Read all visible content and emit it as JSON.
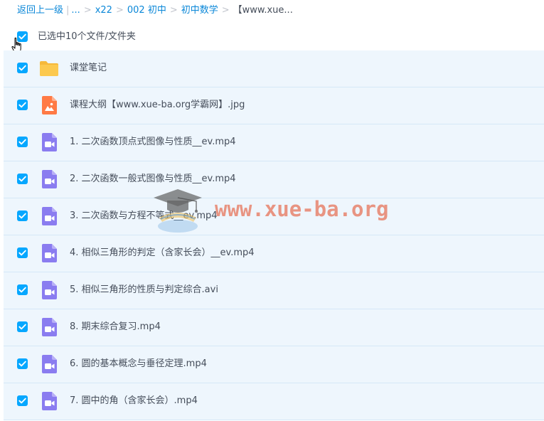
{
  "breadcrumb": {
    "back_label": "返回上一级",
    "ellipsis": "...",
    "items": [
      "x22",
      "002 初中",
      "初中数学"
    ],
    "current": "【www.xue..."
  },
  "selection": {
    "label": "已选中10个文件/文件夹",
    "all_checked": true
  },
  "files": [
    {
      "name": "课堂笔记",
      "type": "folder-icon",
      "checked": true
    },
    {
      "name": "课程大纲【www.xue-ba.org学霸网】.jpg",
      "type": "image-file-icon",
      "checked": true
    },
    {
      "name": "1. 二次函数顶点式图像与性质__ev.mp4",
      "type": "video-file-icon",
      "checked": true
    },
    {
      "name": "2. 二次函数一般式图像与性质__ev.mp4",
      "type": "video-file-icon",
      "checked": true
    },
    {
      "name": "3. 二次函数与方程不等式__ev.mp4",
      "type": "video-file-icon",
      "checked": true
    },
    {
      "name": "4. 相似三角形的判定（含家长会）__ev.mp4",
      "type": "video-file-icon",
      "checked": true
    },
    {
      "name": "5. 相似三角形的性质与判定综合.avi",
      "type": "video-file-icon",
      "checked": true
    },
    {
      "name": "8. 期末综合复习.mp4",
      "type": "video-file-icon",
      "checked": true
    },
    {
      "name": "6. 圆的基本概念与垂径定理.mp4",
      "type": "video-file-icon",
      "checked": true
    },
    {
      "name": "7. 圆中的角（含家长会）.mp4",
      "type": "video-file-icon",
      "checked": true
    }
  ],
  "watermark": {
    "text": "www.xue-ba.org",
    "icon": "graduation-cap-logo-icon"
  },
  "colors": {
    "link": "#0a87d8",
    "checkbox": "#06a7ff",
    "row_bg": "#eef6fd",
    "row_border": "#d5e8f7",
    "folder": "#fcc94f",
    "image_file": "#ff7a45",
    "video_file": "#8a7cf0",
    "text": "#454d5a",
    "watermark": "#e7785f"
  }
}
